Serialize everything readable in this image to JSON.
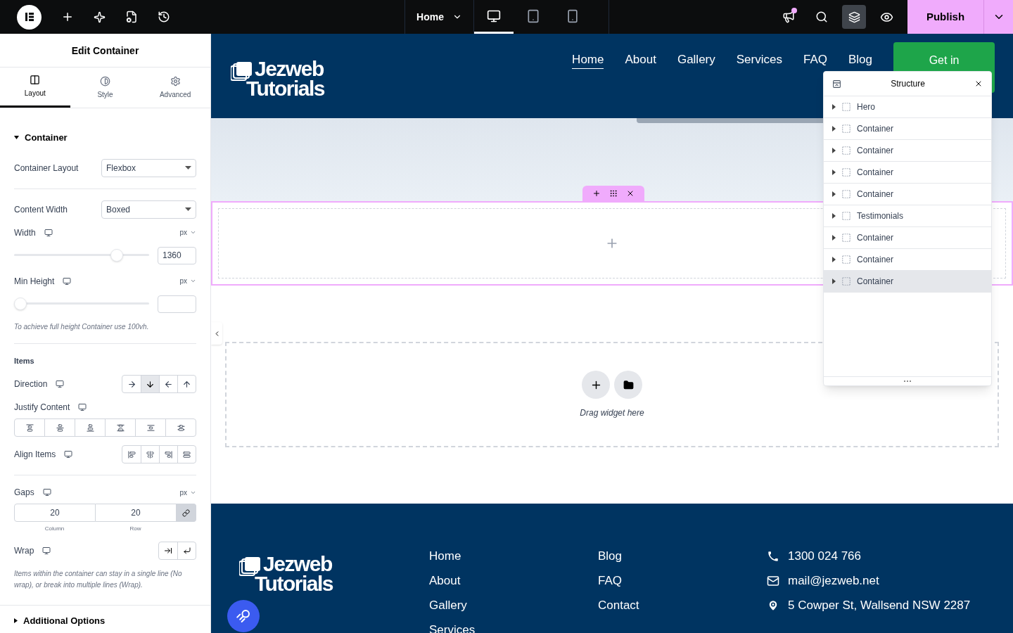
{
  "topbar": {
    "page_menu": "Home",
    "devices": [
      {
        "kind": "desktop",
        "selected": true
      },
      {
        "kind": "tablet",
        "selected": false
      },
      {
        "kind": "mobile",
        "selected": false
      }
    ],
    "layers_active": true,
    "notification": true,
    "publish": "Publish"
  },
  "panel": {
    "title": "Edit Container",
    "tabs": [
      {
        "kind": "layout",
        "label": "Layout",
        "selected": true
      },
      {
        "kind": "style",
        "label": "Style",
        "selected": false
      },
      {
        "kind": "advanced",
        "label": "Advanced",
        "selected": false
      }
    ],
    "section": "Container",
    "container_layout": {
      "label": "Container Layout",
      "value": "Flexbox"
    },
    "content_width": {
      "label": "Content Width",
      "value": "Boxed"
    },
    "width": {
      "label": "Width",
      "unit": "px",
      "level": 0.79,
      "value": "1360"
    },
    "min_height": {
      "label": "Min Height",
      "unit": "px",
      "level": 0
    },
    "min_height_hint": "To achieve full height Container use 100vh.",
    "items_heading": "Items",
    "direction": {
      "label": "Direction",
      "options": [
        {
          "kind": "right",
          "selected": false
        },
        {
          "kind": "down",
          "selected": true
        },
        {
          "kind": "left",
          "selected": false
        },
        {
          "kind": "up",
          "selected": false
        }
      ]
    },
    "justify_label": "Justify Content",
    "align_label": "Align Items",
    "gaps": {
      "label": "Gaps",
      "unit": "px",
      "column": "20",
      "row": "20",
      "column_caption": "Column",
      "row_caption": "Row",
      "linked": true
    },
    "wrap_label": "Wrap",
    "wrap_hint": "Items within the container can stay in a single line (No wrap), or break into multiple lines (Wrap).",
    "additional": "Additional Options"
  },
  "site": {
    "logo": [
      "Jezweb",
      "Tutorials"
    ],
    "nav": [
      {
        "label": "Home",
        "selected": true
      },
      {
        "label": "About",
        "selected": false
      },
      {
        "label": "Gallery",
        "selected": false
      },
      {
        "label": "Services",
        "selected": false
      },
      {
        "label": "FAQ",
        "selected": false
      },
      {
        "label": "Blog",
        "selected": false
      }
    ],
    "cta": "Get in",
    "drop_hint": "Drag widget here",
    "footer": {
      "logo": [
        "Jezweb",
        "Tutorials"
      ],
      "column_1": [
        "Home",
        "About",
        "Gallery",
        "Services"
      ],
      "column_2": [
        "Blog",
        "FAQ",
        "Contact"
      ],
      "contacts": [
        {
          "kind": "phone",
          "text": "1300 024 766"
        },
        {
          "kind": "mail",
          "text": "mail@jezweb.net"
        },
        {
          "kind": "pin",
          "text": "5 Cowper St, Wallsend NSW 2287"
        }
      ]
    }
  },
  "structure": {
    "title": "Structure",
    "items": [
      {
        "label": "Hero",
        "selected": false
      },
      {
        "label": "Container",
        "selected": false
      },
      {
        "label": "Container",
        "selected": false
      },
      {
        "label": "Container",
        "selected": false
      },
      {
        "label": "Container",
        "selected": false
      },
      {
        "label": "Testimonials",
        "selected": false
      },
      {
        "label": "Container",
        "selected": false
      },
      {
        "label": "Container",
        "selected": false
      },
      {
        "label": "Container",
        "selected": true
      }
    ]
  }
}
